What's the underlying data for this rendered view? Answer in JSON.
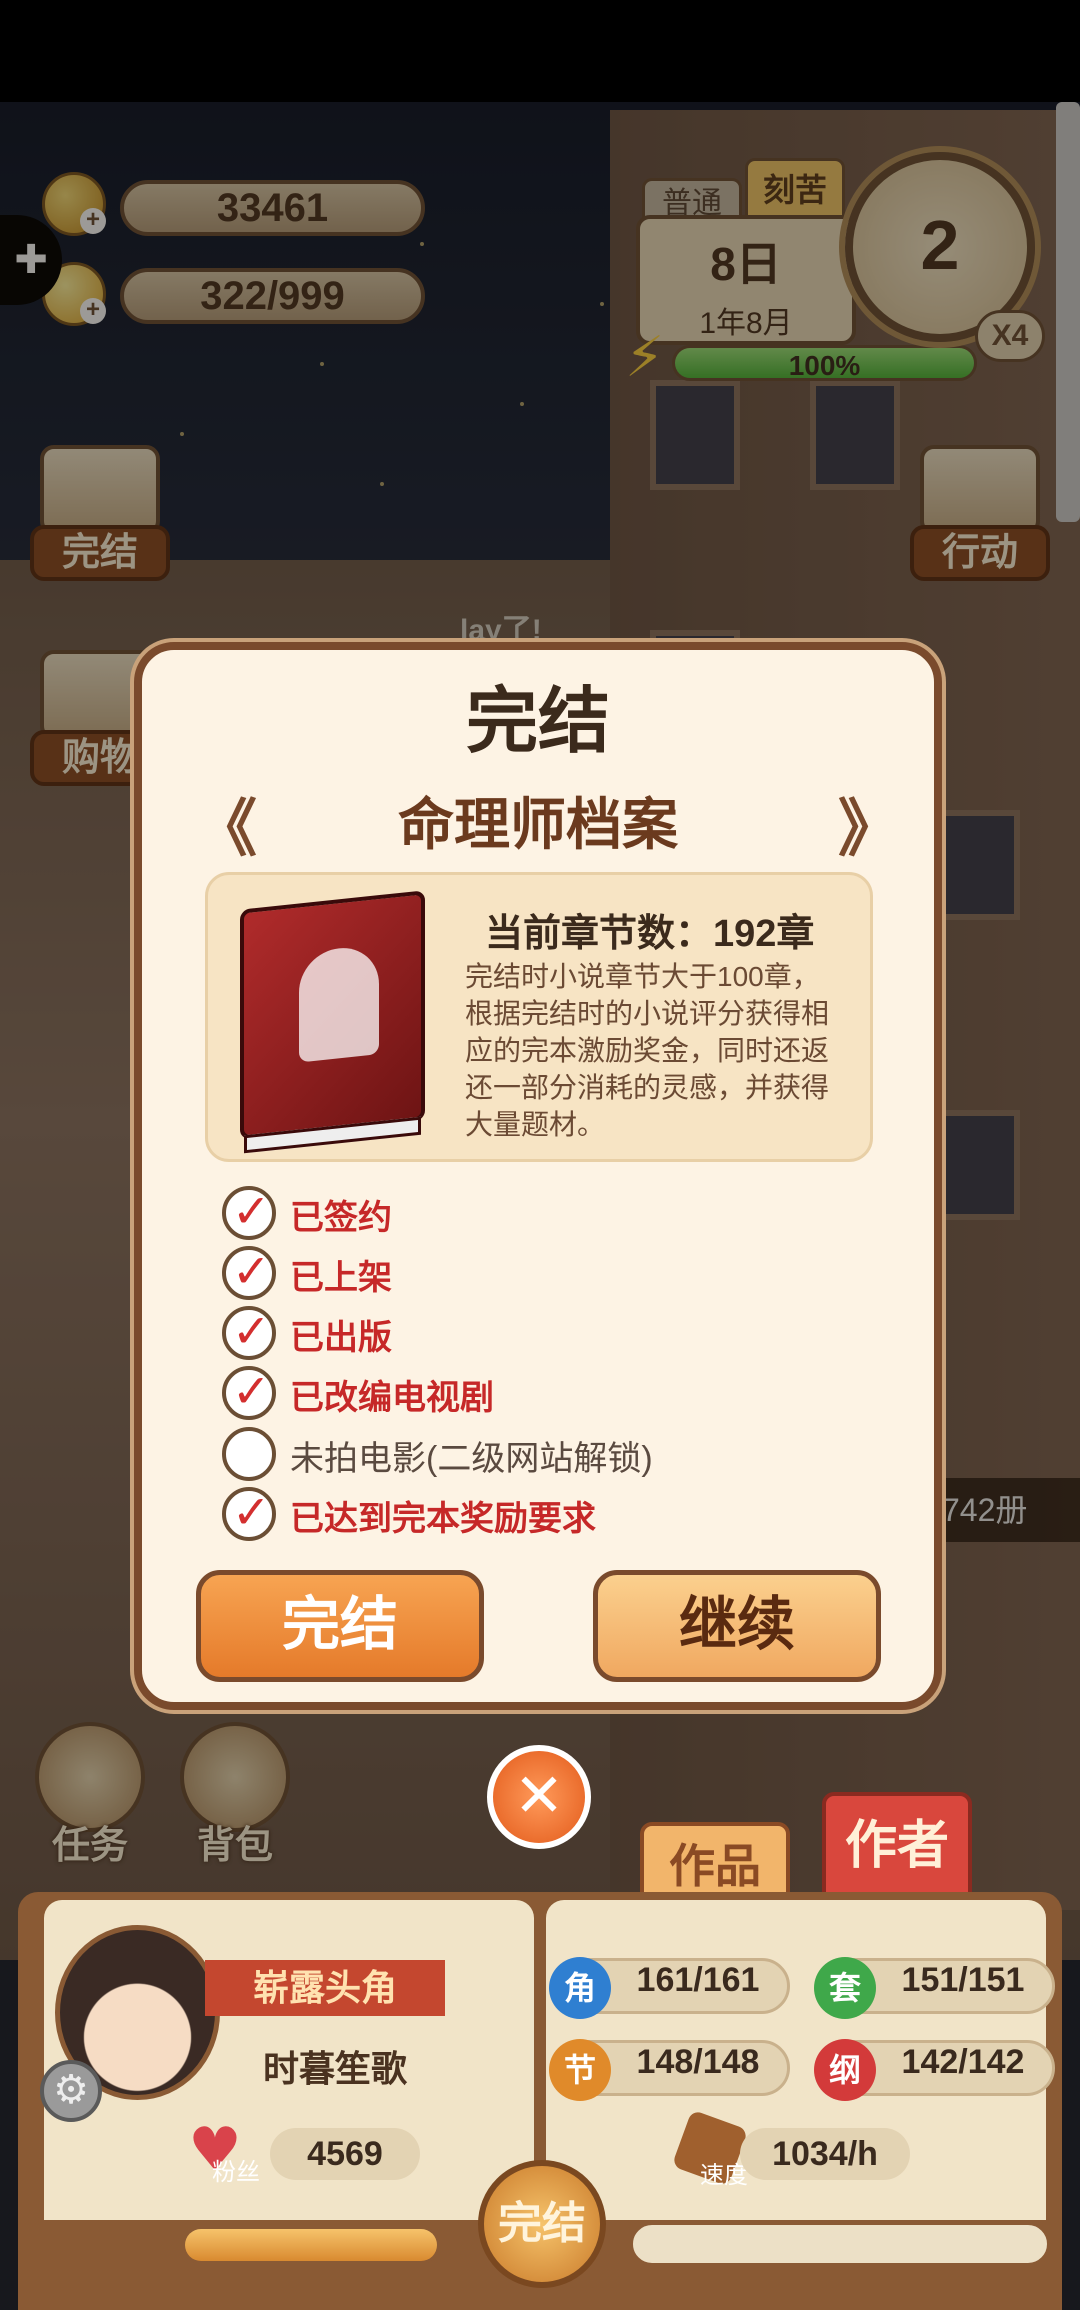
{
  "hud": {
    "coins": "33461",
    "inspiration": "322/999",
    "mode_normal": "普通",
    "mode_hard": "刻苦",
    "day": "8日",
    "year_month": "1年8月",
    "energy_percent": "100%",
    "energy_fraction": 1.0,
    "clock_number": "2",
    "speed_multiplier": "X4",
    "plus": "+"
  },
  "side": {
    "finish_label": "完结",
    "shop_label": "购物",
    "action_label": "行动",
    "task_label": "任务",
    "bag_label": "背包"
  },
  "world": {
    "floating_text": "lay了!",
    "count_right": "742册"
  },
  "modal": {
    "title": "完结",
    "prev_arrow": "《",
    "next_arrow": "》",
    "novel_title": "命理师档案",
    "chapters": "当前章节数：192章",
    "description": "完结时小说章节大于100章，根据完结时的小说评分获得相应的完本激励奖金，同时还返还一部分消耗的灵感，并获得大量题材。",
    "checks": [
      {
        "label": "已签约",
        "done": true
      },
      {
        "label": "已上架",
        "done": true
      },
      {
        "label": "已出版",
        "done": true
      },
      {
        "label": "已改编电视剧",
        "done": true
      },
      {
        "label": "未拍电影(二级网站解锁)",
        "done": false
      },
      {
        "label": "已达到完本奖励要求",
        "done": true
      }
    ],
    "finish_button": "完结",
    "continue_button": "继续",
    "close_symbol": "✕",
    "tick_symbol": "✓"
  },
  "bottom": {
    "tab_works": "作品",
    "tab_author": "作者",
    "rank": "崭露头角",
    "pen_name": "时暮笙歌",
    "fans_label": "粉丝",
    "fans": "4569",
    "speed_label": "速度",
    "speed": "1034/h",
    "stats": {
      "role_badge": "角",
      "role": "161/161",
      "set_badge": "套",
      "set": "151/151",
      "plot_badge": "节",
      "plot": "148/148",
      "outline_badge": "纲",
      "outline": "142/142"
    },
    "finish_center": "完结"
  },
  "colors": {
    "accent_orange": "#e57a2a",
    "check_red": "#d32f2f",
    "frame_brown": "#7a4a2c",
    "badge_blue": "#2f7fd1",
    "badge_green": "#3fa84a",
    "badge_orange": "#e08a2a",
    "badge_red": "#d33a3a"
  }
}
